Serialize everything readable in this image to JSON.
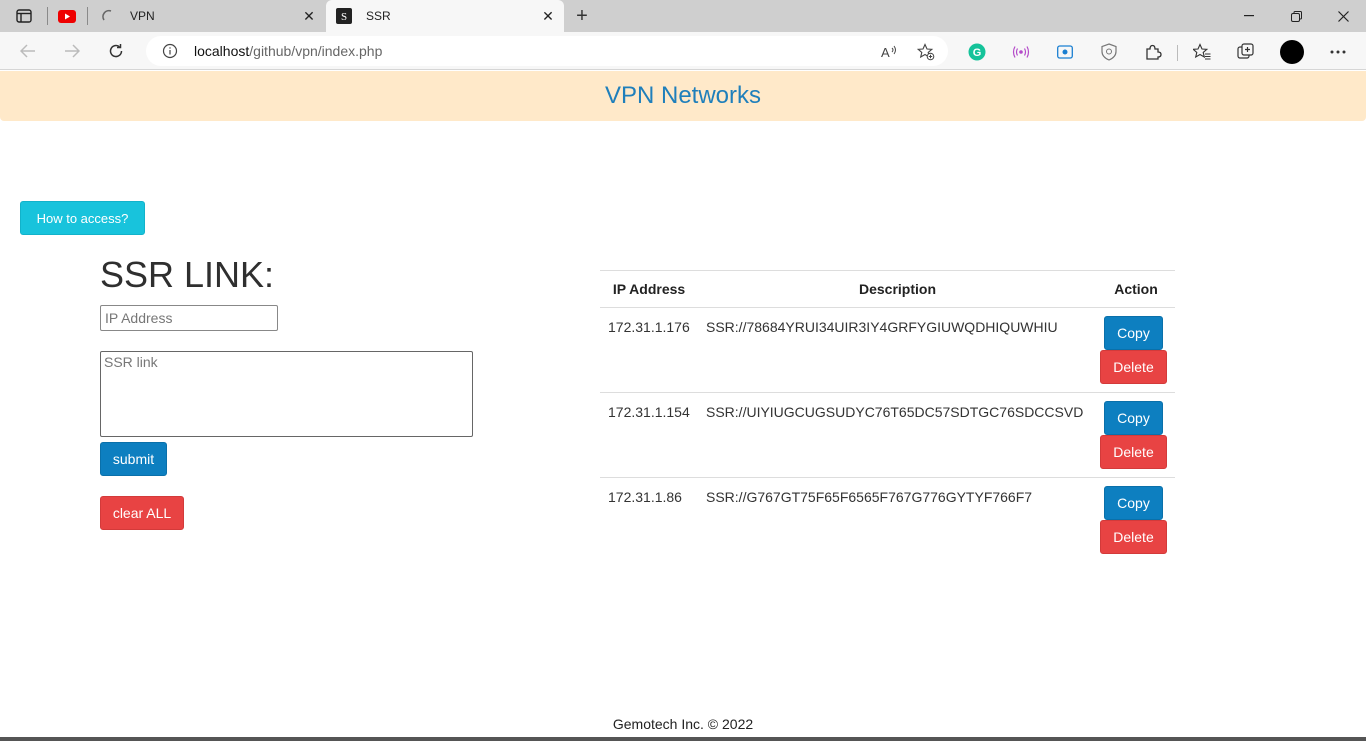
{
  "browser": {
    "tabs": [
      {
        "title": "VPN",
        "active": false
      },
      {
        "title": "SSR",
        "active": true,
        "favicon_letter": "S"
      }
    ],
    "url": {
      "host": "localhost",
      "path": "/github/vpn/index.php"
    }
  },
  "page": {
    "banner_title": "VPN Networks",
    "how_to_button": "How to access?",
    "form": {
      "title": "SSR LINK:",
      "ip_placeholder": "IP Address",
      "ssr_placeholder": "SSR link",
      "submit_label": "submit",
      "clear_label": "clear ALL"
    },
    "table": {
      "headers": [
        "IP Address",
        "Description",
        "Action"
      ],
      "rows": [
        {
          "ip": "172.31.1.176",
          "desc": "SSR://78684YRUI34UIR3IY4GRFYGIUWQDHIQUWHIU"
        },
        {
          "ip": "172.31.1.154",
          "desc": "SSR://UIYIUGCUGSUDYC76T65DC57SDTGC76SDCCSVD"
        },
        {
          "ip": "172.31.1.86",
          "desc": "SSR://G767GT75F65F6565F767G776GYTYF766F7"
        }
      ],
      "copy_label": "Copy",
      "delete_label": "Delete"
    },
    "footer": "Gemotech Inc. © 2022"
  },
  "colors": {
    "banner_bg": "#ffe9c9",
    "banner_text": "#1f7fbb",
    "primary": "#0d7fc0",
    "danger": "#e84343",
    "info": "#18c3dc"
  }
}
